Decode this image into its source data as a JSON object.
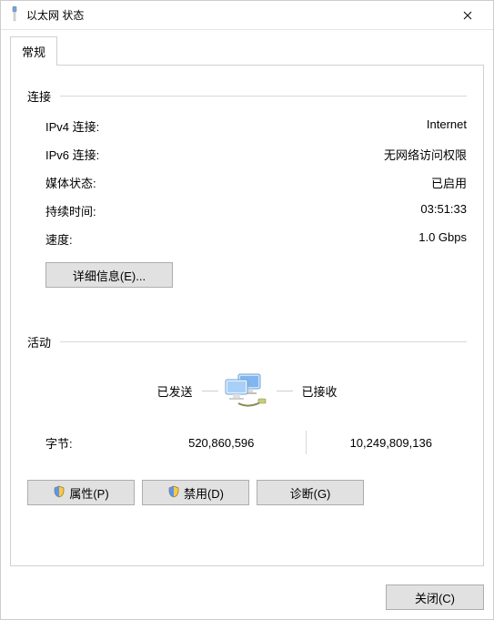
{
  "window": {
    "title": "以太网 状态"
  },
  "tab": {
    "general": "常规"
  },
  "connection": {
    "heading": "连接",
    "ipv4_label": "IPv4 连接:",
    "ipv4_value": "Internet",
    "ipv6_label": "IPv6 连接:",
    "ipv6_value": "无网络访问权限",
    "media_label": "媒体状态:",
    "media_value": "已启用",
    "duration_label": "持续时间:",
    "duration_value": "03:51:33",
    "speed_label": "速度:",
    "speed_value": "1.0 Gbps",
    "details_btn": "详细信息(E)..."
  },
  "activity": {
    "heading": "活动",
    "sent_label": "已发送",
    "recv_label": "已接收",
    "bytes_label": "字节:",
    "bytes_sent": "520,860,596",
    "bytes_recv": "10,249,809,136"
  },
  "buttons": {
    "properties": "属性(P)",
    "disable": "禁用(D)",
    "diagnose": "诊断(G)",
    "close": "关闭(C)"
  }
}
